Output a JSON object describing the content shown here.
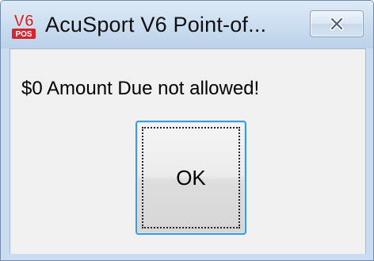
{
  "window": {
    "title": "AcuSport V6 Point-of...",
    "icon": "v6-pos-logo-icon",
    "icon_text_top": "V6",
    "icon_text_bottom": "POS",
    "close_icon": "close-icon"
  },
  "dialog": {
    "message": "$0 Amount Due not allowed!",
    "ok_label": "OK"
  },
  "colors": {
    "titlebar": "#cddff1",
    "client_bg": "#f0f0f0",
    "ok_border": "#3c9be0",
    "logo_red": "#d0282e"
  }
}
